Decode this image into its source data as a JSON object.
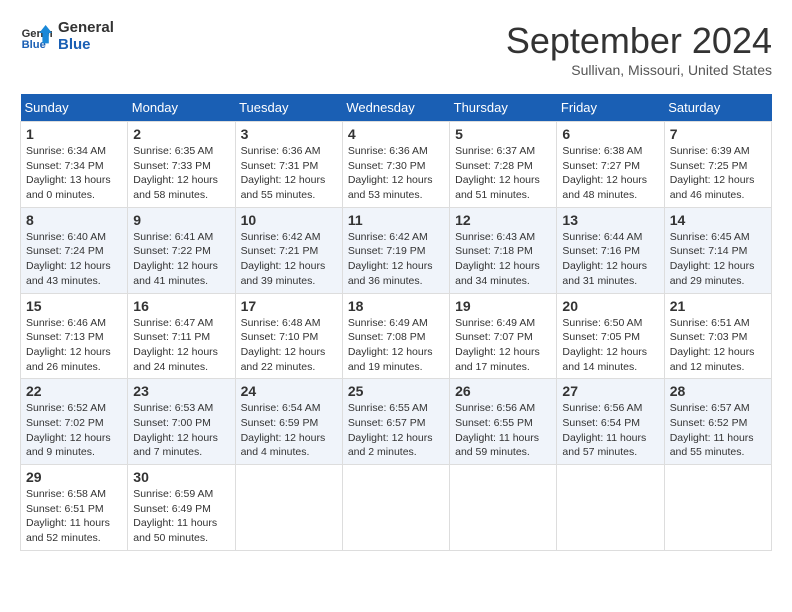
{
  "header": {
    "logo_line1": "General",
    "logo_line2": "Blue",
    "title": "September 2024",
    "subtitle": "Sullivan, Missouri, United States"
  },
  "days_of_week": [
    "Sunday",
    "Monday",
    "Tuesday",
    "Wednesday",
    "Thursday",
    "Friday",
    "Saturday"
  ],
  "weeks": [
    [
      {
        "day": "1",
        "sunrise": "6:34 AM",
        "sunset": "7:34 PM",
        "daylight": "13 hours and 0 minutes."
      },
      {
        "day": "2",
        "sunrise": "6:35 AM",
        "sunset": "7:33 PM",
        "daylight": "12 hours and 58 minutes."
      },
      {
        "day": "3",
        "sunrise": "6:36 AM",
        "sunset": "7:31 PM",
        "daylight": "12 hours and 55 minutes."
      },
      {
        "day": "4",
        "sunrise": "6:36 AM",
        "sunset": "7:30 PM",
        "daylight": "12 hours and 53 minutes."
      },
      {
        "day": "5",
        "sunrise": "6:37 AM",
        "sunset": "7:28 PM",
        "daylight": "12 hours and 51 minutes."
      },
      {
        "day": "6",
        "sunrise": "6:38 AM",
        "sunset": "7:27 PM",
        "daylight": "12 hours and 48 minutes."
      },
      {
        "day": "7",
        "sunrise": "6:39 AM",
        "sunset": "7:25 PM",
        "daylight": "12 hours and 46 minutes."
      }
    ],
    [
      {
        "day": "8",
        "sunrise": "6:40 AM",
        "sunset": "7:24 PM",
        "daylight": "12 hours and 43 minutes."
      },
      {
        "day": "9",
        "sunrise": "6:41 AM",
        "sunset": "7:22 PM",
        "daylight": "12 hours and 41 minutes."
      },
      {
        "day": "10",
        "sunrise": "6:42 AM",
        "sunset": "7:21 PM",
        "daylight": "12 hours and 39 minutes."
      },
      {
        "day": "11",
        "sunrise": "6:42 AM",
        "sunset": "7:19 PM",
        "daylight": "12 hours and 36 minutes."
      },
      {
        "day": "12",
        "sunrise": "6:43 AM",
        "sunset": "7:18 PM",
        "daylight": "12 hours and 34 minutes."
      },
      {
        "day": "13",
        "sunrise": "6:44 AM",
        "sunset": "7:16 PM",
        "daylight": "12 hours and 31 minutes."
      },
      {
        "day": "14",
        "sunrise": "6:45 AM",
        "sunset": "7:14 PM",
        "daylight": "12 hours and 29 minutes."
      }
    ],
    [
      {
        "day": "15",
        "sunrise": "6:46 AM",
        "sunset": "7:13 PM",
        "daylight": "12 hours and 26 minutes."
      },
      {
        "day": "16",
        "sunrise": "6:47 AM",
        "sunset": "7:11 PM",
        "daylight": "12 hours and 24 minutes."
      },
      {
        "day": "17",
        "sunrise": "6:48 AM",
        "sunset": "7:10 PM",
        "daylight": "12 hours and 22 minutes."
      },
      {
        "day": "18",
        "sunrise": "6:49 AM",
        "sunset": "7:08 PM",
        "daylight": "12 hours and 19 minutes."
      },
      {
        "day": "19",
        "sunrise": "6:49 AM",
        "sunset": "7:07 PM",
        "daylight": "12 hours and 17 minutes."
      },
      {
        "day": "20",
        "sunrise": "6:50 AM",
        "sunset": "7:05 PM",
        "daylight": "12 hours and 14 minutes."
      },
      {
        "day": "21",
        "sunrise": "6:51 AM",
        "sunset": "7:03 PM",
        "daylight": "12 hours and 12 minutes."
      }
    ],
    [
      {
        "day": "22",
        "sunrise": "6:52 AM",
        "sunset": "7:02 PM",
        "daylight": "12 hours and 9 minutes."
      },
      {
        "day": "23",
        "sunrise": "6:53 AM",
        "sunset": "7:00 PM",
        "daylight": "12 hours and 7 minutes."
      },
      {
        "day": "24",
        "sunrise": "6:54 AM",
        "sunset": "6:59 PM",
        "daylight": "12 hours and 4 minutes."
      },
      {
        "day": "25",
        "sunrise": "6:55 AM",
        "sunset": "6:57 PM",
        "daylight": "12 hours and 2 minutes."
      },
      {
        "day": "26",
        "sunrise": "6:56 AM",
        "sunset": "6:55 PM",
        "daylight": "11 hours and 59 minutes."
      },
      {
        "day": "27",
        "sunrise": "6:56 AM",
        "sunset": "6:54 PM",
        "daylight": "11 hours and 57 minutes."
      },
      {
        "day": "28",
        "sunrise": "6:57 AM",
        "sunset": "6:52 PM",
        "daylight": "11 hours and 55 minutes."
      }
    ],
    [
      {
        "day": "29",
        "sunrise": "6:58 AM",
        "sunset": "6:51 PM",
        "daylight": "11 hours and 52 minutes."
      },
      {
        "day": "30",
        "sunrise": "6:59 AM",
        "sunset": "6:49 PM",
        "daylight": "11 hours and 50 minutes."
      },
      null,
      null,
      null,
      null,
      null
    ]
  ]
}
